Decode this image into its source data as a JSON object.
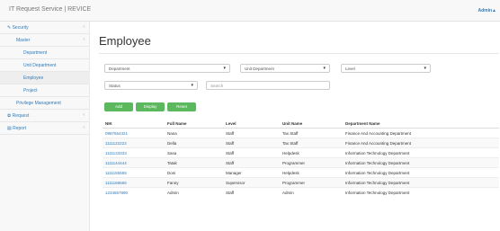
{
  "app": {
    "title": "IT Request Service | REVICE",
    "user": "Admin▲"
  },
  "sidebar": {
    "items": [
      {
        "label": "✎ Security",
        "arrow": "‹"
      },
      {
        "label": "Master",
        "arrow": "‹"
      },
      {
        "label": "Department"
      },
      {
        "label": "Unit Department"
      },
      {
        "label": "Employee"
      },
      {
        "label": "Project"
      },
      {
        "label": "Privilege Management"
      },
      {
        "label": "✿ Request",
        "arrow": "‹"
      },
      {
        "label": "▤ Report",
        "arrow": "‹"
      }
    ]
  },
  "page": {
    "title": "Employee"
  },
  "filters": {
    "department": "Department",
    "unit_department": "Unit Department",
    "level": "Level",
    "status": "Status",
    "search_placeholder": "Search"
  },
  "buttons": {
    "add": "Add",
    "display": "Display",
    "reset": "Reset"
  },
  "table": {
    "headers": [
      "NIK",
      "Full Name",
      "Level",
      "Unit Name",
      "Department Name"
    ],
    "rows": [
      [
        "0987654321",
        "Nana",
        "Staff",
        "Tax Staff",
        "Finance And Accounting Department"
      ],
      [
        "1111122222",
        "Della",
        "Staff",
        "Tax Staff",
        "Finance And Accounting Department"
      ],
      [
        "1111133333",
        "Sasa",
        "Staff",
        "Helpdesk",
        "Information Technology Department"
      ],
      [
        "1111144444",
        "Tatak",
        "Staff",
        "Programmer",
        "Information Technology Department"
      ],
      [
        "1111155555",
        "Doni",
        "Manager",
        "Helpdesk",
        "Information Technology Department"
      ],
      [
        "1111166666",
        "Fanny",
        "Supervisor",
        "Programmer",
        "Information Technology Department"
      ],
      [
        "1234567890",
        "Admin",
        "Staff",
        "Admin",
        "Information Technology Department"
      ]
    ]
  }
}
